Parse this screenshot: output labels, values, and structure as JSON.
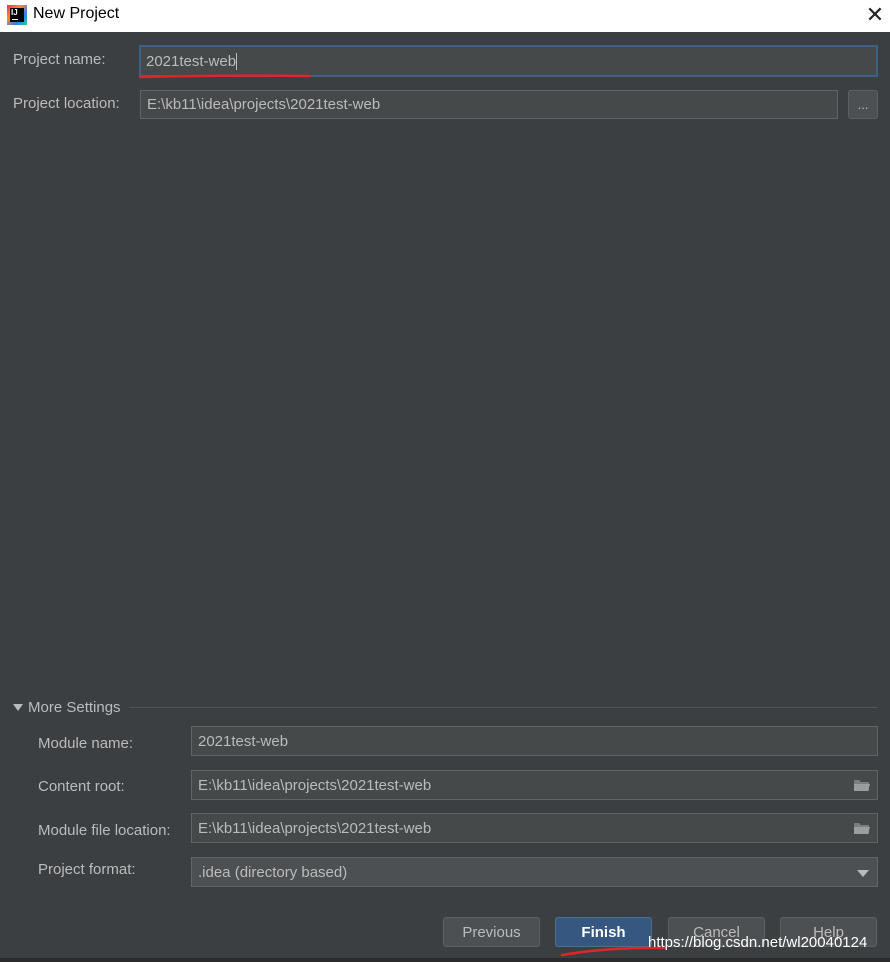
{
  "window": {
    "title": "New Project",
    "close_glyph": "✕"
  },
  "project": {
    "name_label": "Project name:",
    "name_value": "2021test-web",
    "location_label": "Project location:",
    "location_value": "E:\\kb11\\idea\\projects\\2021test-web",
    "browse_label": "..."
  },
  "more_settings": {
    "header": "More Settings",
    "module_name_label": "Module name:",
    "module_name_value": "2021test-web",
    "content_root_label": "Content root:",
    "content_root_value": "E:\\kb11\\idea\\projects\\2021test-web",
    "module_file_label": "Module file location:",
    "module_file_value": "E:\\kb11\\idea\\projects\\2021test-web",
    "format_label": "Project format:",
    "format_value": ".idea (directory based)"
  },
  "buttons": {
    "previous": "Previous",
    "finish": "Finish",
    "cancel": "Cancel",
    "help": "Help"
  },
  "watermark": "https://blog.csdn.net/wl20040124",
  "colors": {
    "background": "#3c3f41",
    "field": "#45494a",
    "primary_button": "#365880",
    "annotation_red": "#e0252a"
  }
}
